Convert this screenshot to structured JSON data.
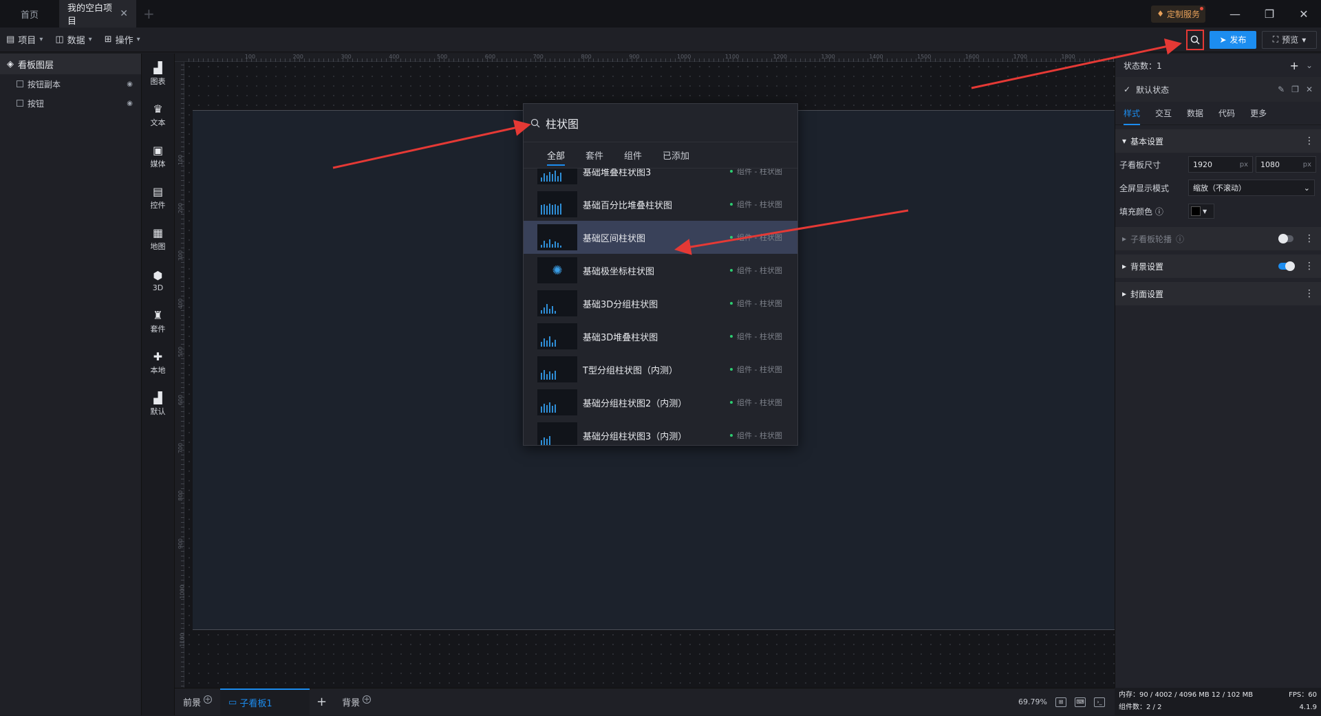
{
  "titlebar": {
    "tabs": [
      {
        "label": "首页"
      },
      {
        "label": "我的空白项目"
      }
    ],
    "custom_service": "定制服务"
  },
  "toolbar": {
    "menus": [
      {
        "label": "项目",
        "icon": "document-icon"
      },
      {
        "label": "数据",
        "icon": "database-icon"
      },
      {
        "label": "操作",
        "icon": "grid-icon"
      }
    ],
    "publish_label": "发布",
    "preview_label": "预览"
  },
  "layers": {
    "title": "看板图层",
    "items": [
      {
        "label": "按钮副本"
      },
      {
        "label": "按钮"
      }
    ]
  },
  "components": {
    "items": [
      {
        "label": "图表",
        "icon": "bar-chart-icon"
      },
      {
        "label": "文本",
        "icon": "text-crown-icon"
      },
      {
        "label": "媒体",
        "icon": "media-icon"
      },
      {
        "label": "控件",
        "icon": "control-icon"
      },
      {
        "label": "地图",
        "icon": "map-icon"
      },
      {
        "label": "3D",
        "icon": "cube-icon"
      },
      {
        "label": "套件",
        "icon": "shirt-icon"
      },
      {
        "label": "本地",
        "icon": "puzzle-icon"
      },
      {
        "label": "默认",
        "icon": "bar-chart-icon"
      }
    ]
  },
  "ruler": {
    "top_labels": [
      "100",
      "200",
      "300",
      "400",
      "500",
      "600",
      "700",
      "800",
      "900",
      "1000",
      "1100",
      "1200",
      "1300",
      "1400",
      "1500",
      "1600",
      "1700",
      "1800"
    ],
    "left_labels": [
      "100",
      "200",
      "300",
      "400",
      "500",
      "600",
      "700",
      "800",
      "900",
      "1000",
      "1100"
    ]
  },
  "bottom": {
    "front_label": "前景",
    "board_label": "子看板1",
    "back_label": "背景",
    "zoom": "69.79%"
  },
  "props": {
    "state_count": "状态数：1",
    "default_state": "默认状态",
    "subtabs": [
      "样式",
      "交互",
      "数据",
      "代码",
      "更多"
    ],
    "basic_section": "基本设置",
    "size_label": "子看板尺寸",
    "width": "1920",
    "height": "1080",
    "unit": "px",
    "fullscreen_label": "全屏显示模式",
    "fullscreen_value": "缩放（不滚动）",
    "fill_label": "填充颜色",
    "carousel_section": "子看板轮播",
    "background_section": "背景设置",
    "cover_section": "封面设置",
    "accent_color": "#1c8df0"
  },
  "status": {
    "memory": "内存：90 / 4002 / 4096 MB  12 / 102 MB",
    "fps": "FPS：60",
    "components": "组件数：2 / 2",
    "version": "4.1.9"
  },
  "search": {
    "query": "柱状图",
    "tabs": [
      "全部",
      "套件",
      "组件",
      "已添加"
    ],
    "results": [
      {
        "name": "基础堆叠柱状图3",
        "category": "组件 - 柱状图"
      },
      {
        "name": "基础百分比堆叠柱状图",
        "category": "组件 - 柱状图"
      },
      {
        "name": "基础区间柱状图",
        "category": "组件 - 柱状图"
      },
      {
        "name": "基础极坐标柱状图",
        "category": "组件 - 柱状图"
      },
      {
        "name": "基础3D分组柱状图",
        "category": "组件 - 柱状图"
      },
      {
        "name": "基础3D堆叠柱状图",
        "category": "组件 - 柱状图"
      },
      {
        "name": "T型分组柱状图（内测）",
        "category": "组件 - 柱状图"
      },
      {
        "name": "基础分组柱状图2（内测）",
        "category": "组件 - 柱状图"
      },
      {
        "name": "基础分组柱状图3（内测）",
        "category": "组件 - 柱状图"
      }
    ]
  }
}
